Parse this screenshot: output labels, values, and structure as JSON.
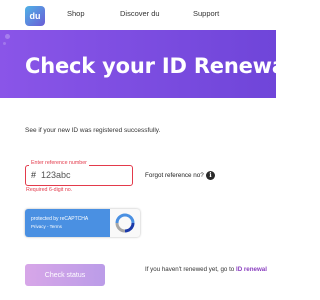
{
  "header": {
    "logo_text": "du",
    "nav": [
      "Shop",
      "Discover du",
      "Support"
    ]
  },
  "hero": {
    "title": "Check your ID Renewal"
  },
  "form": {
    "intro": "See if your new ID was registered successfully.",
    "reference_label": "Enter reference number",
    "reference_prefix": "#",
    "reference_value": "123abc",
    "reference_error": "Required 6-digit no.",
    "forgot_label": "Forgot reference no?",
    "info_icon_glyph": "i",
    "recaptcha_line1": "protected by reCAPTCHA",
    "recaptcha_line2": "Privacy - Terms",
    "check_button": "Check status",
    "renew_prompt": "If you haven't renewed yet, go to",
    "renew_link": "ID renewal"
  },
  "colors": {
    "accent": "#7b4de0",
    "error": "#e33a4b",
    "button": "#cfa2e8",
    "link": "#8a3fbf"
  }
}
